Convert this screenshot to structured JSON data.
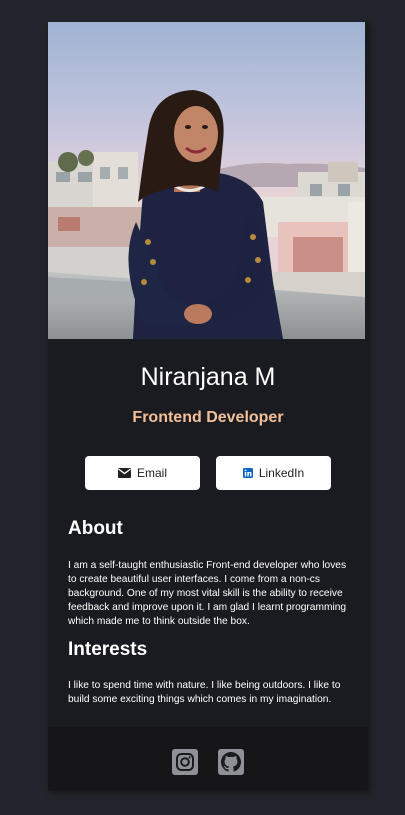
{
  "profile": {
    "photo_alt": "Profile photo",
    "name": "Niranjana M",
    "role": "Frontend Developer"
  },
  "buttons": {
    "email_label": "Email",
    "linkedin_label": "LinkedIn"
  },
  "about": {
    "title": "About",
    "text": "I am a self-taught enthusiastic Front-end developer who loves to create beautiful user interfaces. I come from a non-cs background. One of my most vital skill is the ability to receive feedback and improve upon it. I am glad I learnt programming which made me to think outside the box."
  },
  "interests": {
    "title": "Interests",
    "text": "I like to spend time with nature. I like being outdoors. I like to build some exciting things which comes in my imagination."
  },
  "footer": {
    "icons": [
      "instagram-icon",
      "github-icon"
    ]
  },
  "colors": {
    "page_bg": "#23252c",
    "card_bg": "#1a1b20",
    "footer_bg": "#161619",
    "accent": "#f3bf99",
    "linkedin_blue": "#0a66c2"
  }
}
